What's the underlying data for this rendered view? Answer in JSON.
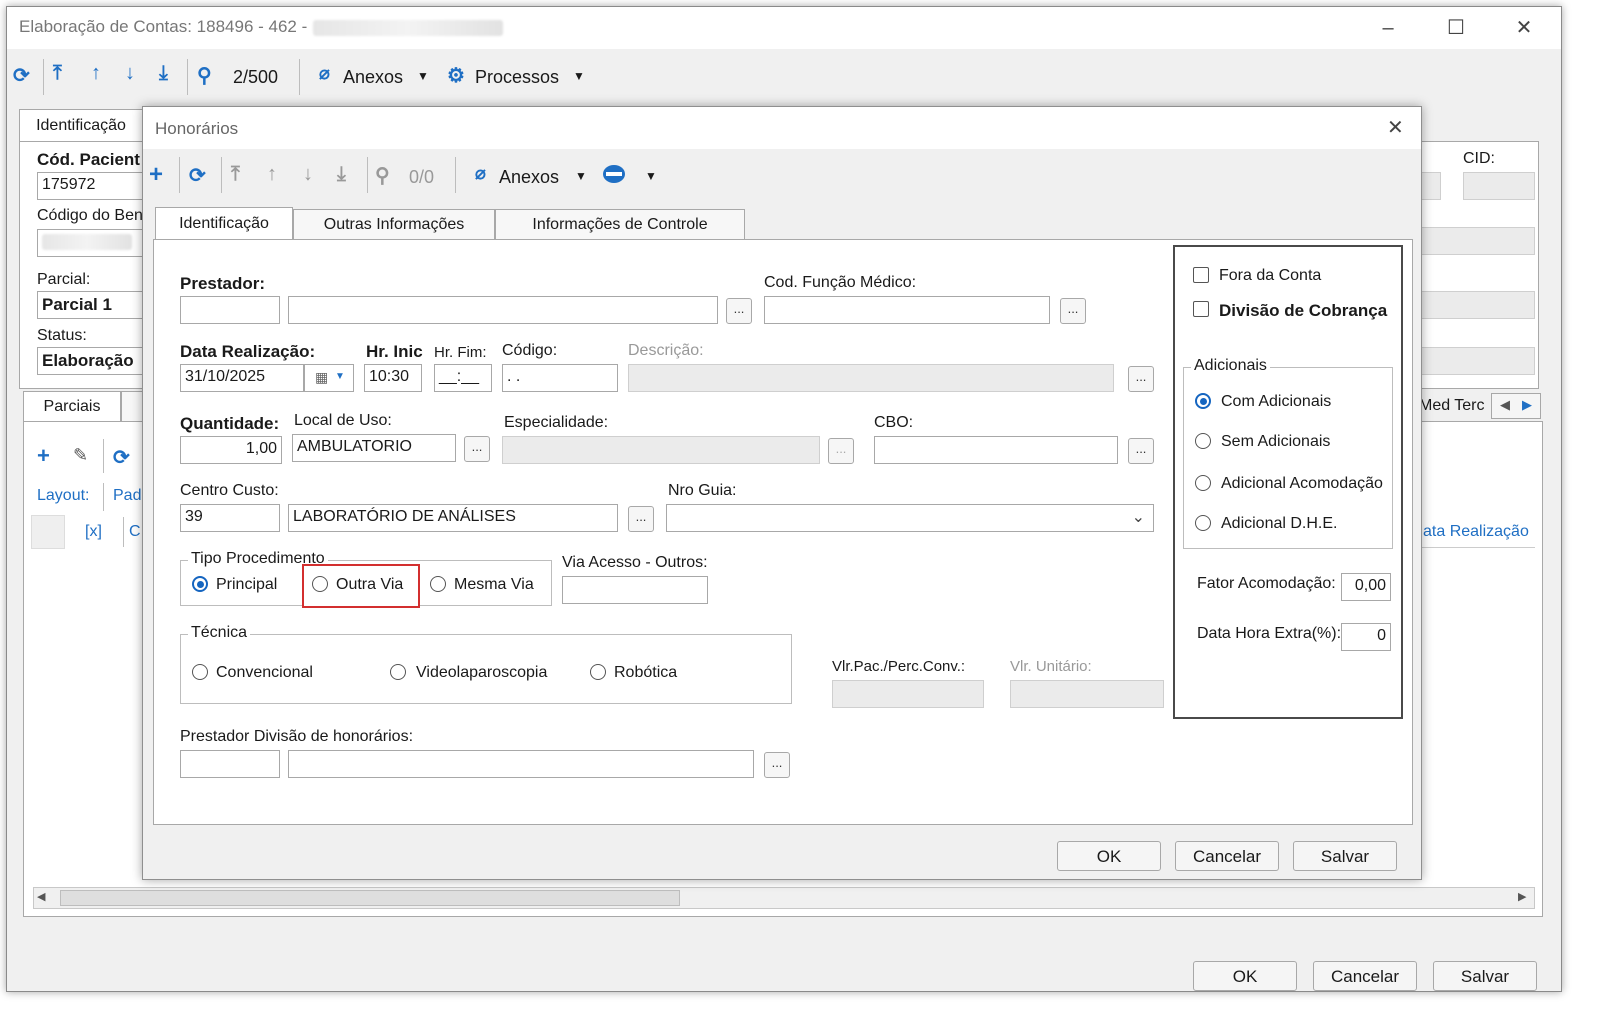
{
  "main_window": {
    "title": "Elaboração de Contas: 188496 - 462 -",
    "controls": {
      "minimize": "–",
      "maximize": "☐",
      "close": "✕"
    },
    "toolbar": {
      "record_counter": "2/500",
      "anexos": "Anexos",
      "processos": "Processos"
    },
    "tabs": {
      "identificacao": "Identificação",
      "parciais": "Parciais",
      "med_terc": "Med Terc"
    },
    "labels": {
      "cod_paciente": "Cód. Pacient",
      "cod_paciente_value": "175972",
      "codigo_ben": "Código do Ben",
      "parcial": "Parcial:",
      "parcial_value": "Parcial 1",
      "status": "Status:",
      "status_value": "Elaboração",
      "cid": "CID:",
      "layout": "Layout:",
      "layout_value": "Pad",
      "col_x": "[x]",
      "col_c": "C",
      "data_realizacao_col": "ata Realização"
    },
    "footer": {
      "ok": "OK",
      "cancelar": "Cancelar",
      "salvar": "Salvar"
    }
  },
  "dialog": {
    "title": "Honorários",
    "toolbar": {
      "counter": "0/0",
      "anexos": "Anexos"
    },
    "tabs": [
      "Identificação",
      "Outras Informações",
      "Informações de Controle"
    ],
    "fields": {
      "prestador": {
        "label": "Prestador:",
        "code": "",
        "name": ""
      },
      "cod_funcao_medico": {
        "label": "Cod. Função Médico:",
        "value": ""
      },
      "data_realizacao": {
        "label": "Data Realização:",
        "value": "31/10/2025"
      },
      "hr_inicio": {
        "label": "Hr. Inic",
        "value": "10:30"
      },
      "hr_fim": {
        "label": "Hr. Fim:",
        "value": "__:__"
      },
      "codigo": {
        "label": "Código:",
        "value": ". ."
      },
      "descricao": {
        "label": "Descrição:",
        "value": ""
      },
      "quantidade": {
        "label": "Quantidade:",
        "value": "1,00"
      },
      "local_uso": {
        "label": "Local de Uso:",
        "value": "AMBULATORIO"
      },
      "especialidade": {
        "label": "Especialidade:",
        "value": ""
      },
      "cbo": {
        "label": "CBO:",
        "value": ""
      },
      "centro_custo": {
        "label": "Centro Custo:",
        "code": "39",
        "name": "LABORATÓRIO DE ANÁLISES"
      },
      "nro_guia": {
        "label": "Nro Guia:",
        "value": ""
      },
      "via_acesso": {
        "label": "Via Acesso - Outros:",
        "value": ""
      },
      "vlr_pac": {
        "label": "Vlr.Pac./Perc.Conv.:",
        "value": ""
      },
      "vlr_unitario": {
        "label": "Vlr. Unitário:",
        "value": ""
      },
      "prestador_divisao": {
        "label": "Prestador Divisão de honorários:",
        "code": "",
        "name": ""
      },
      "fator_acomodacao": {
        "label": "Fator Acomodação:",
        "value": "0,00"
      },
      "data_hora_extra": {
        "label": "Data Hora Extra(%):",
        "value": "0"
      }
    },
    "tipo_procedimento": {
      "title": "Tipo Procedimento",
      "options": [
        "Principal",
        "Outra Via",
        "Mesma Via"
      ],
      "selected": "Principal"
    },
    "tecnica": {
      "title": "Técnica",
      "options": [
        "Convencional",
        "Videolaparoscopia",
        "Robótica"
      ]
    },
    "checkboxes": {
      "fora_da_conta": "Fora da Conta",
      "divisao_cobranca": "Divisão de Cobrança"
    },
    "adicionais": {
      "title": "Adicionais",
      "options": [
        "Com Adicionais",
        "Sem Adicionais",
        "Adicional Acomodação",
        "Adicional D.H.E."
      ],
      "selected": "Com Adicionais"
    },
    "ellipsis": "...",
    "footer": {
      "ok": "OK",
      "cancelar": "Cancelar",
      "salvar": "Salvar"
    }
  },
  "highlight_color": "#d32f2f",
  "accent_color": "#1565c0"
}
